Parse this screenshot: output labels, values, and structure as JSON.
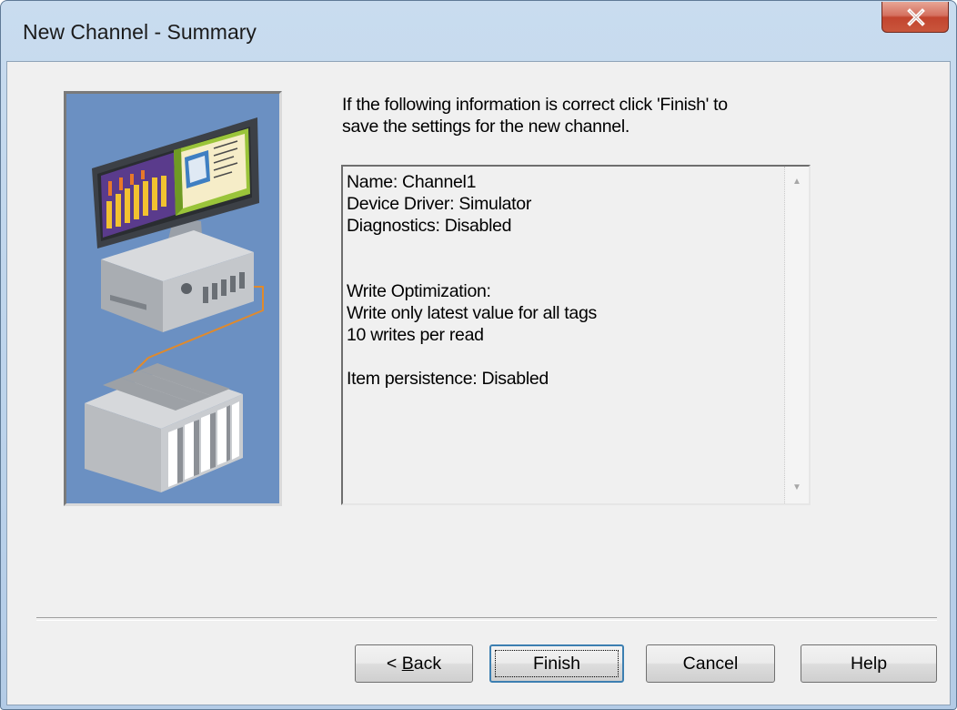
{
  "window": {
    "title": "New Channel - Summary"
  },
  "instruction": {
    "line1": "If the following information is correct click 'Finish' to",
    "line2": "save the settings for the new channel."
  },
  "summary": {
    "lines": [
      "Name: Channel1",
      "Device Driver: Simulator",
      "Diagnostics: Disabled",
      "",
      "",
      "Write Optimization:",
      "Write only latest value for all tags",
      "10 writes per read",
      "",
      "Item persistence: Disabled"
    ]
  },
  "buttons": {
    "back_prefix": "< ",
    "back_mnemonic": "B",
    "back_rest": "ack",
    "finish": "Finish",
    "cancel": "Cancel",
    "help": "Help"
  },
  "colors": {
    "illustration_bg": "#6b90c2",
    "close_button": "#c9553c",
    "dialog_bg": "#f0f0f0"
  }
}
